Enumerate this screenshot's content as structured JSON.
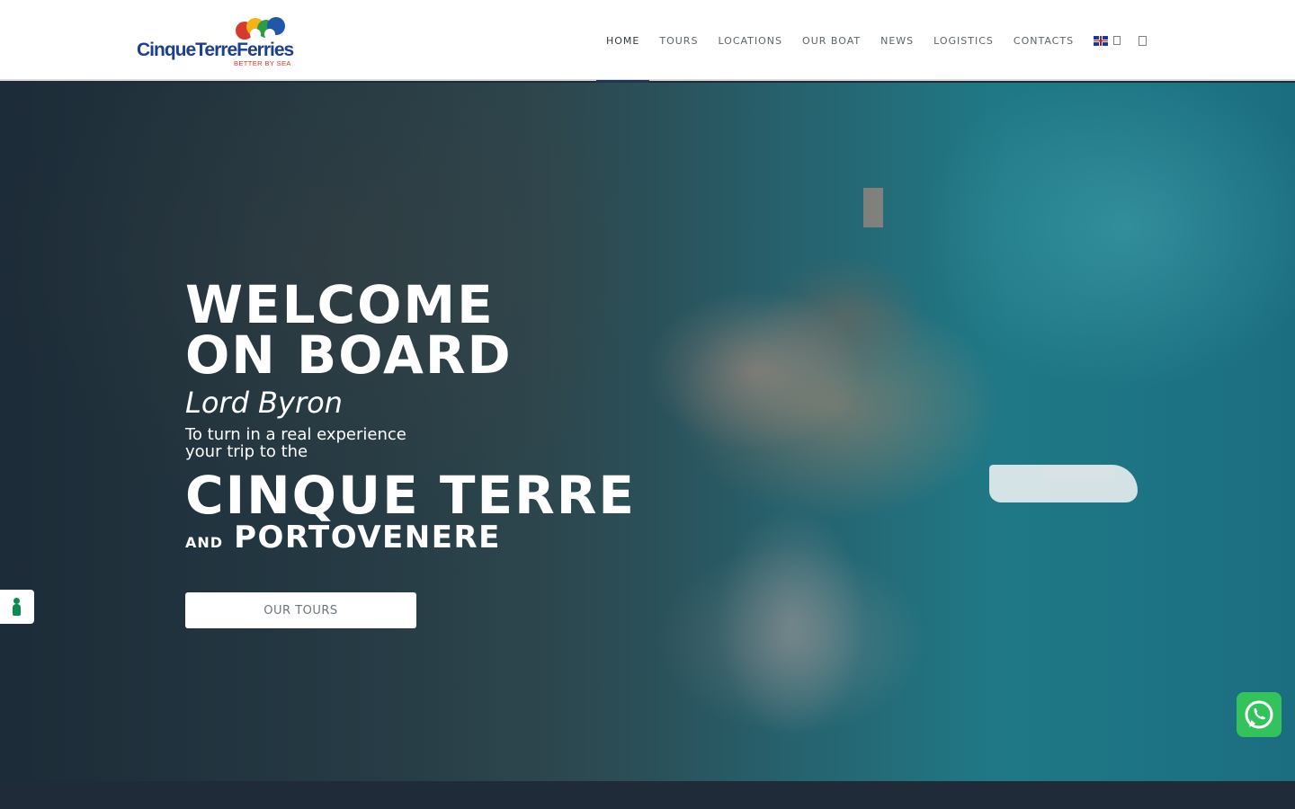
{
  "header": {
    "logo": {
      "name": "CinqueTerreFerries",
      "tagline": "BETTER BY SEA"
    },
    "nav": [
      {
        "label": "HOME",
        "active": true
      },
      {
        "label": "TOURS",
        "active": false
      },
      {
        "label": "LOCATIONS",
        "active": false
      },
      {
        "label": "OUR BOAT",
        "active": false
      },
      {
        "label": "NEWS",
        "active": false
      },
      {
        "label": "LOGISTICS",
        "active": false
      },
      {
        "label": "CONTACTS",
        "active": false
      }
    ],
    "language_icon": "uk-flag-icon",
    "search_icon": "search-icon"
  },
  "hero": {
    "line1": "WELCOME",
    "line2": "ON BOARD",
    "boat_name": "Lord Byron",
    "subtitle_line1": "To turn in a real experience",
    "subtitle_line2": "your trip to the",
    "destination": "CINQUE TERRE",
    "conjunction": "AND",
    "destination2": "PORTOVENERE",
    "cta_label": "OUR TOURS"
  },
  "widgets": {
    "accessibility_icon": "accessibility-icon",
    "whatsapp_icon": "whatsapp-icon"
  },
  "colors": {
    "brand_blue": "#1e3f8a",
    "brand_red": "#d7322d",
    "nav_active_underline": "#1f3556",
    "whatsapp_green": "#33c25b",
    "accessibility_green": "#0c8a52"
  }
}
